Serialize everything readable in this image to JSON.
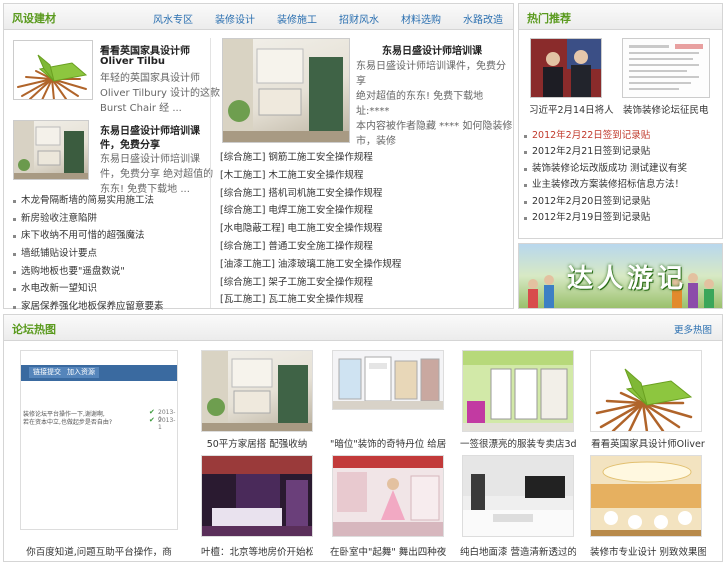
{
  "left": {
    "title": "风设建材",
    "tabs": [
      "风水专区",
      "装修设计",
      "装修施工",
      "招财风水",
      "材料选购",
      "水路改造"
    ],
    "feature1": {
      "title": "看看英国家具设计师",
      "subtitle": "Oliver Tilbu",
      "desc": [
        "年轻的英国家具设计师",
        "Oliver Tilbury 设计的这款",
        "Burst Chair 经 ..."
      ]
    },
    "feature2": {
      "title": "东易日盛设计师培训课",
      "subtitle": "件，免费分享",
      "desc": [
        "东易日盛设计师培训课",
        "件，免费分享 绝对超值的",
        "东东! 免费下载地 ..."
      ]
    },
    "bullets": [
      "木龙骨隔断墙的简易实用施工法",
      "新房验收注意陷阱",
      "床下收纳不用可惜的超强魔法",
      "墙纸铺贴设计要点",
      "选购地板也要\"遥盘数说\"",
      "水电改新一望知识",
      "家居保养强化地板保养应留意要素"
    ],
    "feature3": {
      "title": "东易日盛设计师培训课",
      "desc": [
        "东易日盛设计师培训课件，免费分享",
        "绝对超值的东东! 免费下载地址:****",
        "本内容被作者隐藏 **** 如何隐装修",
        "市，装修"
      ]
    },
    "links": [
      "[综合施工] 钢筋工施工安全操作规程",
      "[木工施工] 木工施工安全操作规程",
      "[综合施工] 搭机司机施工安全操作规程",
      "[综合施工] 电焊工施工安全操作规程",
      "[水电隐蔽工程] 电工施工安全操作规程",
      "[综合施工] 普通工安全施工操作规程",
      "[油漆工施工] 油漆玻璃工施工安全操作规程",
      "[综合施工] 架子工施工安全操作规程",
      "[瓦工施工] 瓦工施工安全操作规程"
    ]
  },
  "right": {
    "title": "热门推荐",
    "captions": [
      "习近平2月14日将人",
      "装饰装修论坛征民电"
    ],
    "news": [
      {
        "text": "2012年2月22日签到记录贴",
        "red": true
      },
      {
        "text": "2012年2月21日签到记录贴",
        "red": false
      },
      {
        "text": "装饰装修论坛改版成功 测试建议有奖",
        "red": false
      },
      {
        "text": "业主装修改方案装修招标信息方法！",
        "red": false
      },
      {
        "text": "2012年2月20日签到记录贴",
        "red": false
      },
      {
        "text": "2012年2月19日签到记录贴",
        "red": false
      }
    ],
    "banner_text": "达人游记"
  },
  "forum": {
    "title": "论坛热图",
    "more": "更多热图",
    "screenshot_buttons": [
      "链接提交",
      "加入资源"
    ],
    "screenshot_lines": [
      "装修论坛平台操作一下,谢谢啊,",
      "若在资本中立,也做起步是否自由?"
    ],
    "screenshot_nums": [
      "2013-0",
      "2013-1"
    ],
    "items": [
      "你百度知道,问题互助平台操作，商",
      "50平方家居搭 配强收纳",
      "\"暗位\"装饰的奇特丹位 给居",
      "一签很漂亮的服装专卖店3d",
      "看看英国家具设计师Oliver",
      "叶檀：北京等地房价开始松",
      "在卧室中\"起舞\" 舞出四种夜",
      "纯白地面漆 营造清新透过的",
      "装修市专业设计 别致效果图"
    ]
  }
}
